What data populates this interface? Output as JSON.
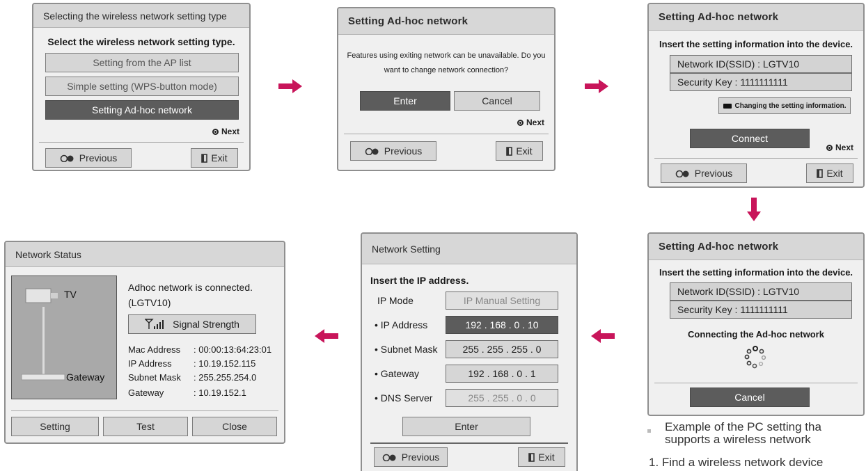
{
  "dialog1": {
    "title": "Selecting the wireless network setting type",
    "heading": "Select the wireless network setting type.",
    "options": [
      "Setting from the AP list",
      "Simple setting (WPS-button mode)",
      "Setting Ad-hoc network"
    ],
    "selected_index": 2,
    "next_label": "Next",
    "previous_label": "Previous",
    "exit_label": "Exit"
  },
  "dialog2": {
    "title": "Setting Ad-hoc network",
    "message_line1": "Features using exiting network can be unavailable. Do you",
    "message_line2": "want to change network connection?",
    "enter_label": "Enter",
    "cancel_label": "Cancel",
    "next_label": "Next",
    "previous_label": "Previous",
    "exit_label": "Exit"
  },
  "dialog3": {
    "title": "Setting Ad-hoc network",
    "heading": "Insert the setting information into the device.",
    "ssid_text": "Network ID(SSID) : LGTV10",
    "key_text": "Security Key : 1111111111",
    "hint_text": "Changing the setting information.",
    "connect_label": "Connect",
    "next_label": "Next",
    "previous_label": "Previous",
    "exit_label": "Exit"
  },
  "dialog4": {
    "title": "Setting Ad-hoc network",
    "heading": "Insert the setting information into the device.",
    "ssid_text": "Network ID(SSID) : LGTV10",
    "key_text": "Security Key : 1111111111",
    "status_text": "Connecting the Ad-hoc network",
    "cancel_label": "Cancel"
  },
  "dialog5": {
    "title": "Network Setting",
    "heading": "Insert the IP address.",
    "ip_mode_label": "IP Mode",
    "ip_mode_value": "IP Manual Setting",
    "rows": [
      {
        "label": "• IP Address",
        "value": "192 . 168 . 0 . 10"
      },
      {
        "label": "• Subnet Mask",
        "value": "255 . 255 . 255 . 0"
      },
      {
        "label": "• Gateway",
        "value": "192 . 168 . 0 . 1"
      },
      {
        "label": "• DNS Server",
        "value": "255 . 255 . 0 . 0"
      }
    ],
    "enter_label": "Enter",
    "previous_label": "Previous",
    "exit_label": "Exit"
  },
  "dialog6": {
    "title": "Network Status",
    "tv_label": "TV",
    "gateway_label": "Gateway",
    "status_line1": "Adhoc network is connected.",
    "status_line2": "(LGTV10)",
    "signal_label": "Signal Strength",
    "info": [
      {
        "key": "Mac Address",
        "value": ": 00:00:13:64:23:01"
      },
      {
        "key": "IP Address",
        "value": ": 10.19.152.115"
      },
      {
        "key": "Subnet Mask",
        "value": ": 255.255.254.0"
      },
      {
        "key": "Gateway",
        "value": ": 10.19.152.1"
      }
    ],
    "setting_label": "Setting",
    "test_label": "Test",
    "close_label": "Close"
  },
  "note": {
    "bullet_line1": "Example of the PC setting tha",
    "bullet_line2": "supports a wireless network",
    "step_line": "1. Find a wireless network device"
  },
  "colors": {
    "arrow": "#c8155a",
    "selected": "#5c5c5c",
    "title_bar": "#d7d7d7",
    "panel": "#f0f0f0"
  },
  "icons": {
    "previous": "previous-circles-icon",
    "exit": "exit-door-icon",
    "next": "next-dot-icon",
    "arrow": "pink-arrow-icon"
  }
}
